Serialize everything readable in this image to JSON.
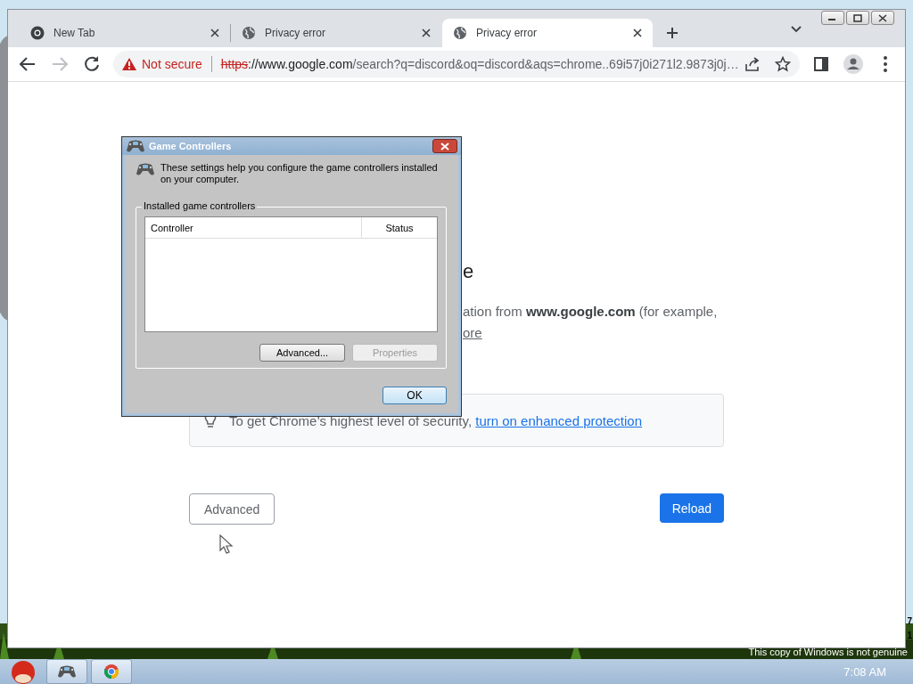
{
  "desktop": {
    "edge_texts": [
      "7",
      "1"
    ],
    "genuine_notice": "This copy of Windows is not genuine"
  },
  "browser": {
    "tabs": [
      {
        "title": "New Tab",
        "kind": "newtab",
        "selected": false
      },
      {
        "title": "Privacy error",
        "kind": "globe",
        "selected": false
      },
      {
        "title": "Privacy error",
        "kind": "globe",
        "selected": true
      }
    ],
    "toolbar": {
      "back_disabled": false,
      "forward_disabled": true
    },
    "omnibox": {
      "security_label": "Not secure",
      "scheme": "https",
      "host": "://www.google.com",
      "path": "/search?q=discord&oq=discord&aqs=chrome..69i57j0i271l2.9873j0j…"
    }
  },
  "page": {
    "heading_fragment": "e",
    "paragraph_fragment": "ation from **www.google.com** (for example,",
    "link_fragment": "ore",
    "tip": {
      "text": "To get Chrome’s highest level of security,",
      "link": "turn on enhanced protection"
    },
    "buttons": [
      {
        "label": "Advanced",
        "kind": "secondary"
      },
      {
        "label": "Reload",
        "kind": "primary"
      }
    ]
  },
  "dialog": {
    "title": "Game Controllers",
    "description": "These settings help you configure the game controllers installed on your computer.",
    "group_label": "Installed game controllers",
    "columns": [
      "Controller",
      "Status"
    ],
    "buttons": [
      {
        "label": "Advanced...",
        "disabled": false
      },
      {
        "label": "Properties",
        "disabled": true
      }
    ],
    "ok": "OK"
  },
  "taskbar": {
    "items": [
      {
        "kind": "gamepad"
      },
      {
        "kind": "browser"
      }
    ],
    "clock": "7:08 AM"
  }
}
